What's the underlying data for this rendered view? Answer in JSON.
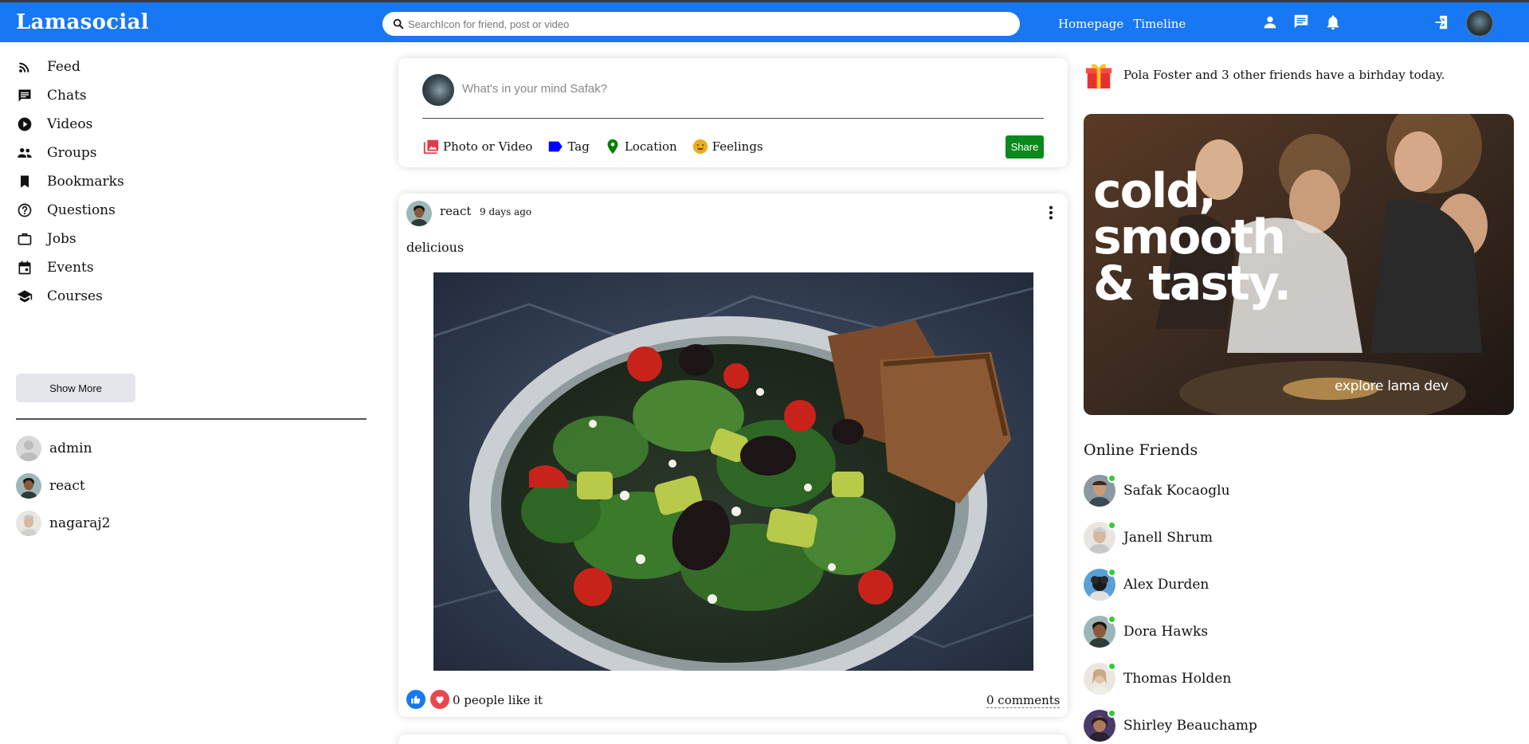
{
  "topbar": {
    "logo": "Lamasocial",
    "search_placeholder": "SearchIcon for friend, post or video",
    "links": [
      "Homepage",
      "Timeline"
    ],
    "icons": [
      "person-icon",
      "chat-icon",
      "notifications-icon",
      "logout-icon"
    ],
    "accent_color": "#1877f2"
  },
  "sidebar": {
    "items": [
      {
        "label": "Feed",
        "icon": "rss-feed-icon"
      },
      {
        "label": "Chats",
        "icon": "chat-icon"
      },
      {
        "label": "Videos",
        "icon": "play-circle-icon"
      },
      {
        "label": "Groups",
        "icon": "group-icon"
      },
      {
        "label": "Bookmarks",
        "icon": "bookmark-icon"
      },
      {
        "label": "Questions",
        "icon": "help-outline-icon"
      },
      {
        "label": "Jobs",
        "icon": "work-outline-icon"
      },
      {
        "label": "Events",
        "icon": "event-icon"
      },
      {
        "label": "Courses",
        "icon": "school-icon"
      }
    ],
    "show_more_label": "Show More",
    "friends": [
      {
        "name": "admin"
      },
      {
        "name": "react"
      },
      {
        "name": "nagaraj2"
      }
    ]
  },
  "share": {
    "placeholder": "What's in your mind Safak?",
    "options": [
      {
        "label": "Photo or Video",
        "icon": "perm-media-icon",
        "color": "#e63946"
      },
      {
        "label": "Tag",
        "icon": "label-icon",
        "color": "#0000ff"
      },
      {
        "label": "Location",
        "icon": "room-icon",
        "color": "#008000"
      },
      {
        "label": "Feelings",
        "icon": "emoji-emotions-icon",
        "color": "#d4a017"
      }
    ],
    "share_label": "Share",
    "share_color": "#0b8a1b"
  },
  "post": {
    "username": "react",
    "date": "9 days ago",
    "text": "delicious",
    "image": "salad-bowl-photo",
    "likes_text": "0 people like it",
    "comments_text": "0 comments"
  },
  "rightbar": {
    "birthday_text": "Pola Foster and 3 other friends have a birhday today.",
    "ad": {
      "title": "cold,\nsmooth\n& tasty.",
      "subtitle": "explore lama dev"
    },
    "online_title": "Online Friends",
    "online_friends": [
      {
        "name": "Safak Kocaoglu"
      },
      {
        "name": "Janell Shrum"
      },
      {
        "name": "Alex Durden"
      },
      {
        "name": "Dora Hawks"
      },
      {
        "name": "Thomas Holden"
      },
      {
        "name": "Shirley Beauchamp"
      }
    ],
    "online_color": "#32cd32"
  }
}
